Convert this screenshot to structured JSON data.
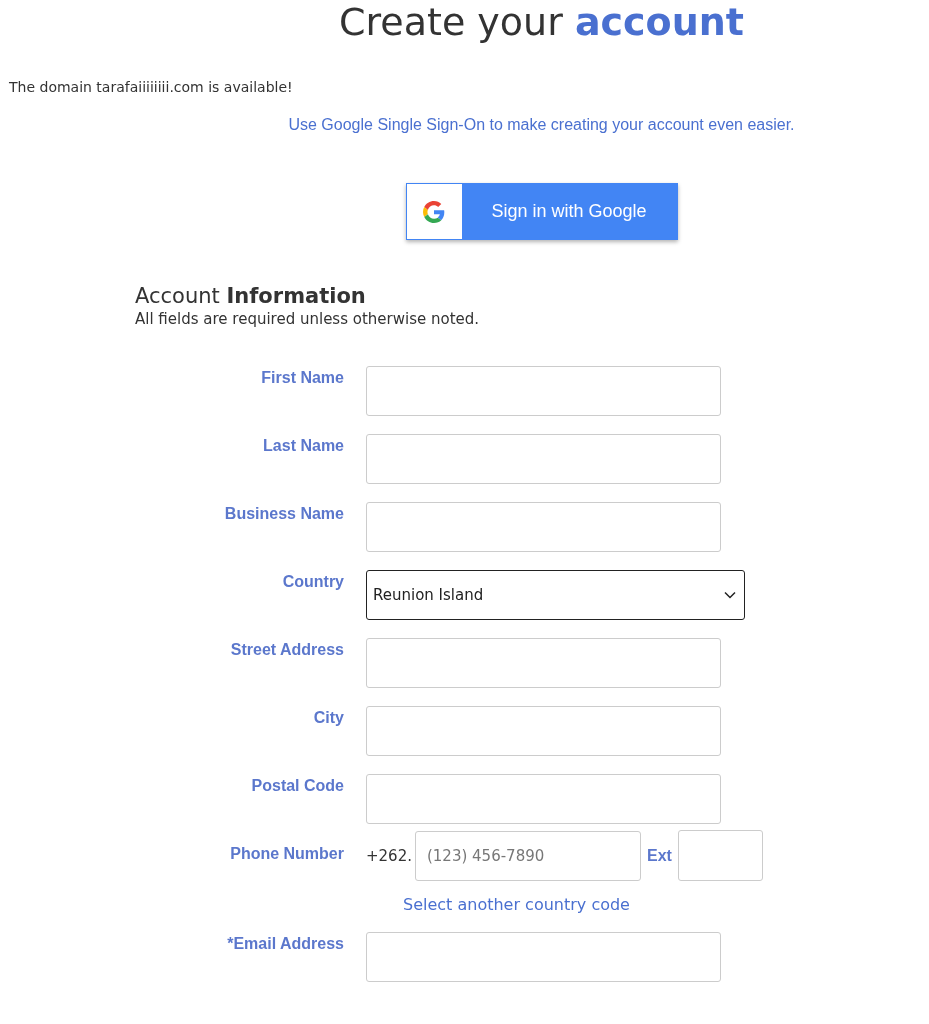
{
  "header": {
    "title": "Create your **account**",
    "domain_notice": "The domain tarafaiiiiiiii.com is available!"
  },
  "sso": {
    "prompt": "Use Google Single Sign-On to make creating your account even easier.",
    "button": "Sign in with Google"
  },
  "section": {
    "heading": "Account **Information**",
    "note": "All fields are required unless otherwise noted."
  },
  "fields": [
    {
      "kind": "text",
      "label": "First Name"
    },
    {
      "kind": "text",
      "label": "Last Name"
    },
    {
      "kind": "text",
      "label": "Business Name"
    },
    {
      "kind": "select",
      "label": "Country",
      "value": "Reunion Island"
    },
    {
      "kind": "text",
      "label": "Street Address"
    },
    {
      "kind": "text",
      "label": "City"
    },
    {
      "kind": "text",
      "label": "Postal Code"
    },
    {
      "kind": "phone",
      "label": "Phone Number",
      "prefix": "+262.",
      "placeholder": "(123) 456-7890",
      "ext_label": "Ext",
      "link": "Select another country code"
    },
    {
      "kind": "text",
      "label": "*Email Address"
    }
  ]
}
